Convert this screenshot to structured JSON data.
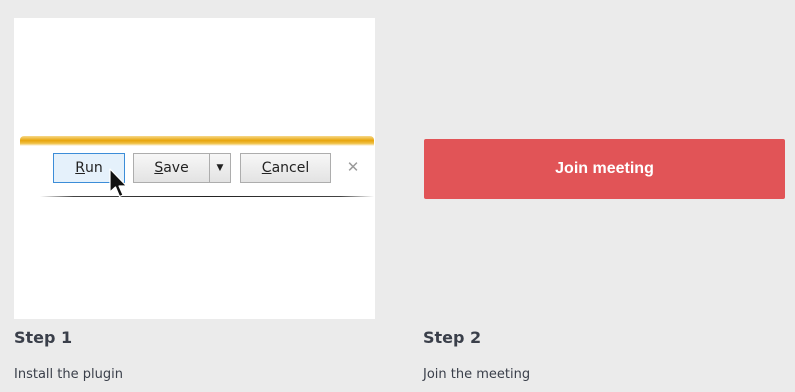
{
  "steps": [
    {
      "title": "Step 1",
      "description": "Install the plugin",
      "download_bar": {
        "run_mnemonic": "R",
        "run_rest": "un",
        "save_mnemonic": "S",
        "save_rest": "ave",
        "dropdown_glyph": "▼",
        "cancel_mnemonic": "C",
        "cancel_rest": "ancel",
        "close_glyph": "✕"
      }
    },
    {
      "title": "Step 2",
      "description": "Join the meeting",
      "join_button_label": "Join meeting"
    }
  ],
  "colors": {
    "page_background": "#ebebeb",
    "join_button": "#e15457",
    "text": "#3a3f4a",
    "download_bar_accent": "#e8a40a"
  },
  "icons": [
    "mouse-cursor-icon",
    "dropdown-arrow-icon",
    "close-icon"
  ]
}
